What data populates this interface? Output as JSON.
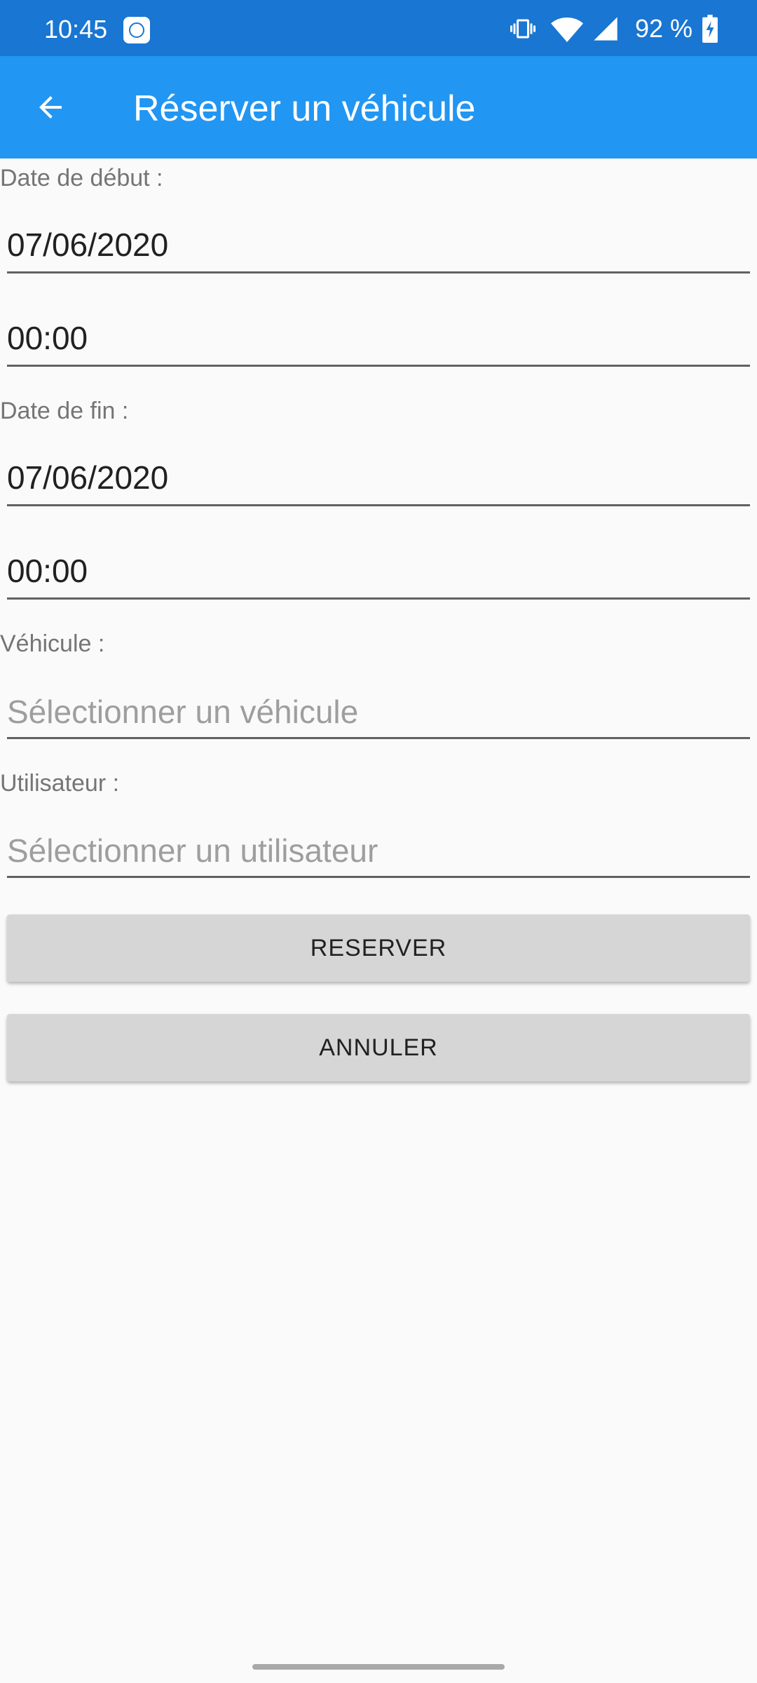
{
  "status_bar": {
    "time": "10:45",
    "battery_text": "92 %",
    "icons": [
      "app-notification-icon",
      "vibrate-icon",
      "wifi-icon",
      "cell-signal-icon",
      "battery-charging-icon"
    ],
    "bg_color": "#1976d2"
  },
  "app_bar": {
    "title": "Réserver un véhicule",
    "back_icon": "arrow-back-icon",
    "bg_color": "#2196f3"
  },
  "form": {
    "start_label": "Date de début :",
    "start_date": "07/06/2020",
    "start_time": "00:00",
    "end_label": "Date de fin :",
    "end_date": "07/06/2020",
    "end_time": "00:00",
    "vehicle_label": "Véhicule :",
    "vehicle_placeholder": "Sélectionner un véhicule",
    "user_label": "Utilisateur :",
    "user_placeholder": "Sélectionner un utilisateur"
  },
  "buttons": {
    "reserve": "RESERVER",
    "cancel": "ANNULER"
  }
}
